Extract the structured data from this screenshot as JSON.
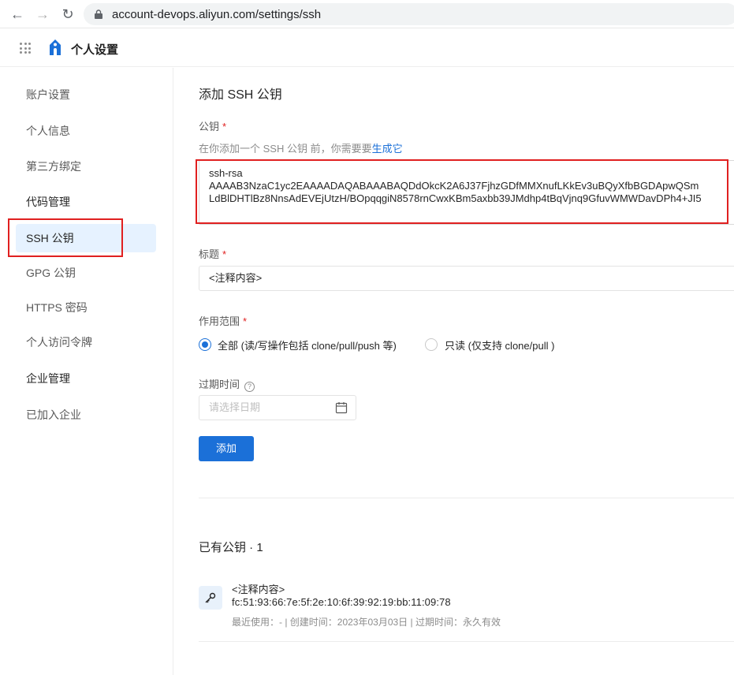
{
  "browser": {
    "url": "account-devops.aliyun.com/settings/ssh"
  },
  "header": {
    "title": "个人设置"
  },
  "sidebar": {
    "items": [
      {
        "label": "账户设置"
      },
      {
        "label": "个人信息"
      },
      {
        "label": "第三方绑定"
      },
      {
        "label": "代码管理"
      },
      {
        "label": "SSH 公钥"
      },
      {
        "label": "GPG 公钥"
      },
      {
        "label": "HTTPS 密码"
      },
      {
        "label": "个人访问令牌"
      },
      {
        "label": "企业管理"
      },
      {
        "label": "已加入企业"
      }
    ],
    "active": "SSH 公钥"
  },
  "form": {
    "section_title": "添加 SSH 公钥",
    "key_label": "公钥",
    "required_mark": "*",
    "hint_prefix": "在你添加一个 SSH 公钥 前，你需要要",
    "hint_link": "生成它",
    "key_value": "ssh-rsa\nAAAAB3NzaC1yc2EAAAADAQABAAABAQDdOkcK2A6J37FjhzGDfMMXnufLKkEv3uBQyXfbBGDApwQSm\nLdBlDHTlBz8NnsAdEVEjUtzH/BOpqqgiN8578rnCwxKBm5axbb39JMdhp4tBqVjnq9GfuvWMWDavDPh4+JI5",
    "title_label": "标题",
    "title_value": "<注释内容>",
    "scope_label": "作用范围",
    "scope_options": [
      {
        "label": "全部 (读/写操作包括 clone/pull/push 等)",
        "checked": true
      },
      {
        "label": "只读 (仅支持 clone/pull )",
        "checked": false
      }
    ],
    "expire_label": "过期时间",
    "expire_placeholder": "请选择日期",
    "add_button": "添加"
  },
  "existing": {
    "title": "已有公钥 · 1",
    "keys": [
      {
        "name": "<注释内容>",
        "fingerprint": "fc:51:93:66:7e:5f:2e:10:6f:39:92:19:bb:11:09:78",
        "meta": "最近使用：-  |  创建时间：2023年03月03日  |  过期时间：永久有效"
      }
    ]
  },
  "colors": {
    "accent": "#1b70d8",
    "highlight_box": "#e02020",
    "active_bg": "#e6f2ff"
  }
}
